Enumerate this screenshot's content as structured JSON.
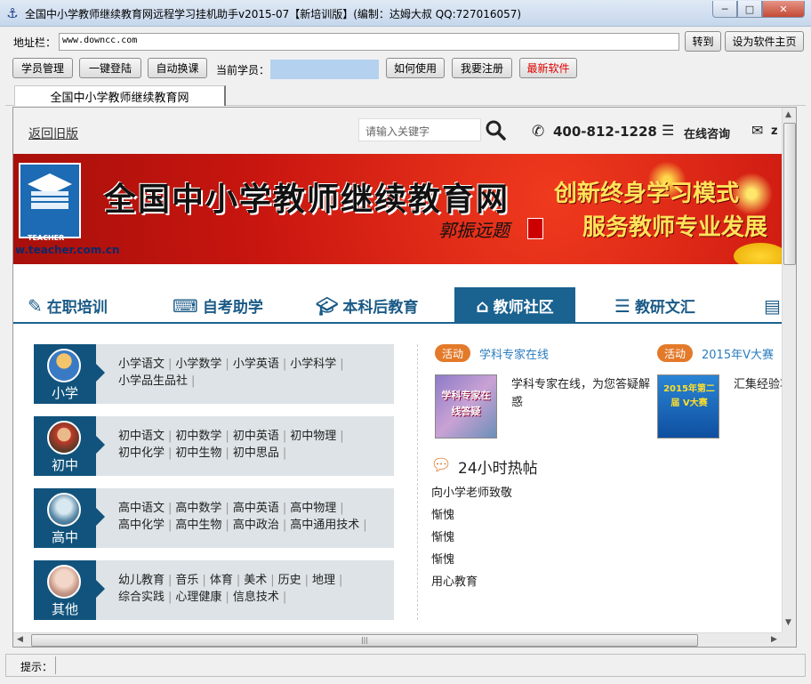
{
  "window": {
    "title": "全国中小学教师继续教育网远程学习挂机助手v2015-07【新培训版】(编制：达姆大叔 QQ:727016057)",
    "icon": "anchor-icon",
    "controls": {
      "minimize": "─",
      "maximize": "□",
      "close": "✕"
    }
  },
  "address_bar": {
    "label": "地址栏：",
    "value": "www.downcc.com",
    "go_button": "转到",
    "home_button": "设为软件主页"
  },
  "toolbar": {
    "students": "学员管理",
    "one_click_login": "一键登陆",
    "auto_switch": "自动换课",
    "current_student_label": "当前学员：",
    "current_student_value": "",
    "how_to_use": "如何使用",
    "register": "我要注册",
    "new_software": "最新软件",
    "new_software_color": "#e00000"
  },
  "tab": {
    "label": "全国中小学教师继续教育网"
  },
  "web": {
    "old_version_link": "返回旧版",
    "search_placeholder": "请输入关键字",
    "phone": "400-812-1228",
    "online_consult": "在线咨询",
    "mail_partial": "z",
    "banner": {
      "logo_text": "TEACHER",
      "url": "w.teacher.com.cn",
      "title": "全国中小学教师继续教育网",
      "signature": "郭振远题",
      "slogan_line1": "创新终身学习模式",
      "slogan_line2": "服务教师专业发展"
    },
    "nav": [
      {
        "label": "在职培训",
        "icon": "teacher-icon"
      },
      {
        "label": "自考助学",
        "icon": "keyboard-icon"
      },
      {
        "label": "本科后教育",
        "icon": "graduation-cap-icon"
      },
      {
        "label": "教师社区",
        "icon": "home-icon",
        "active": true
      },
      {
        "label": "教研文汇",
        "icon": "server-icon"
      },
      {
        "label": "",
        "icon": "clipboard-icon"
      }
    ],
    "categories": [
      {
        "name": "小学",
        "links": [
          "小学语文",
          "小学数学",
          "小学英语",
          "小学科学",
          "小学品生品社"
        ]
      },
      {
        "name": "初中",
        "links": [
          "初中语文",
          "初中数学",
          "初中英语",
          "初中物理",
          "初中化学",
          "初中生物",
          "初中思品"
        ]
      },
      {
        "name": "高中",
        "links": [
          "高中语文",
          "高中数学",
          "高中英语",
          "高中物理",
          "高中化学",
          "高中生物",
          "高中政治",
          "高中通用技术"
        ]
      },
      {
        "name": "其他",
        "links": [
          "幼儿教育",
          "音乐",
          "体育",
          "美术",
          "历史",
          "地理",
          "综合实践",
          "心理健康",
          "信息技术"
        ]
      }
    ],
    "activities": [
      {
        "badge": "活动",
        "title": "学科专家在线",
        "image_text": "学科专家在线答疑",
        "desc": "学科专家在线，为您答疑解惑"
      },
      {
        "badge": "活动",
        "title": "2015年V大赛",
        "image_text": "2015年第二届 V大赛",
        "desc": "汇集经验功和喜悦"
      }
    ],
    "hot_posts": {
      "title": "24小时热帖",
      "items": [
        "向小学老师致敬",
        "惭愧",
        "惭愧",
        "惭愧",
        "用心教育"
      ]
    }
  },
  "status_bar": {
    "label": "提示：",
    "message": ""
  }
}
